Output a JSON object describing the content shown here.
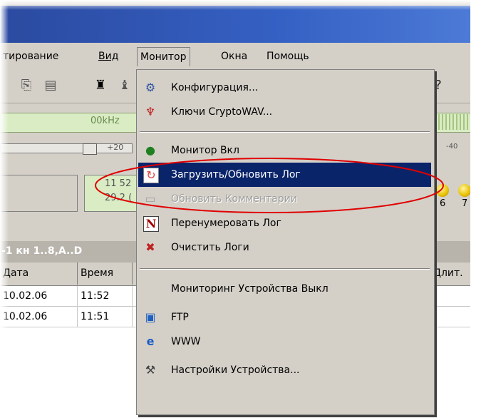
{
  "menubar": {
    "items": [
      {
        "label": "тирование"
      },
      {
        "label": "Вид"
      },
      {
        "label": "Монитор"
      },
      {
        "label": "Окна"
      },
      {
        "label": "Помощь"
      }
    ]
  },
  "toolbar": {
    "freq_label": "00kHz",
    "scale_label": "+20",
    "scale_right": "-40"
  },
  "status": {
    "led_line1": "11 52",
    "led_line2": "29.2 (",
    "bulb_label_1": "6",
    "bulb_label_2": "7"
  },
  "grid": {
    "title": "-1  кн 1..8,A..D",
    "columns": [
      "Дата",
      "Время",
      "Длит."
    ],
    "rows": [
      {
        "date": "10.02.06",
        "time": "11:52"
      },
      {
        "date": "10.02.06",
        "time": "11:51"
      }
    ]
  },
  "monitor_menu": {
    "items": [
      {
        "label": "Конфигурация...",
        "icon": "configuration-icon"
      },
      {
        "label": "Ключи CryptoWAV...",
        "icon": "crypto-keys-icon"
      },
      {
        "label": "Монитор Вкл",
        "icon": "monitor-on-icon"
      },
      {
        "label": "Загрузить/Обновить Лог",
        "icon": "refresh-log-icon"
      },
      {
        "label": "Обновить Комментарии",
        "icon": "comments-icon"
      },
      {
        "label": "Перенумеровать Лог",
        "icon": "renumber-icon"
      },
      {
        "label": "Очистить Логи",
        "icon": "clear-logs-icon"
      },
      {
        "label": "Мониторинг Устройства Выкл",
        "icon": ""
      },
      {
        "label": "FTP",
        "icon": "ftp-icon"
      },
      {
        "label": "WWW",
        "icon": "www-icon"
      },
      {
        "label": "Настройки Устройства...",
        "icon": "device-settings-icon"
      }
    ]
  },
  "colors": {
    "selection": "#0a246a",
    "annotation": "#e00000"
  }
}
